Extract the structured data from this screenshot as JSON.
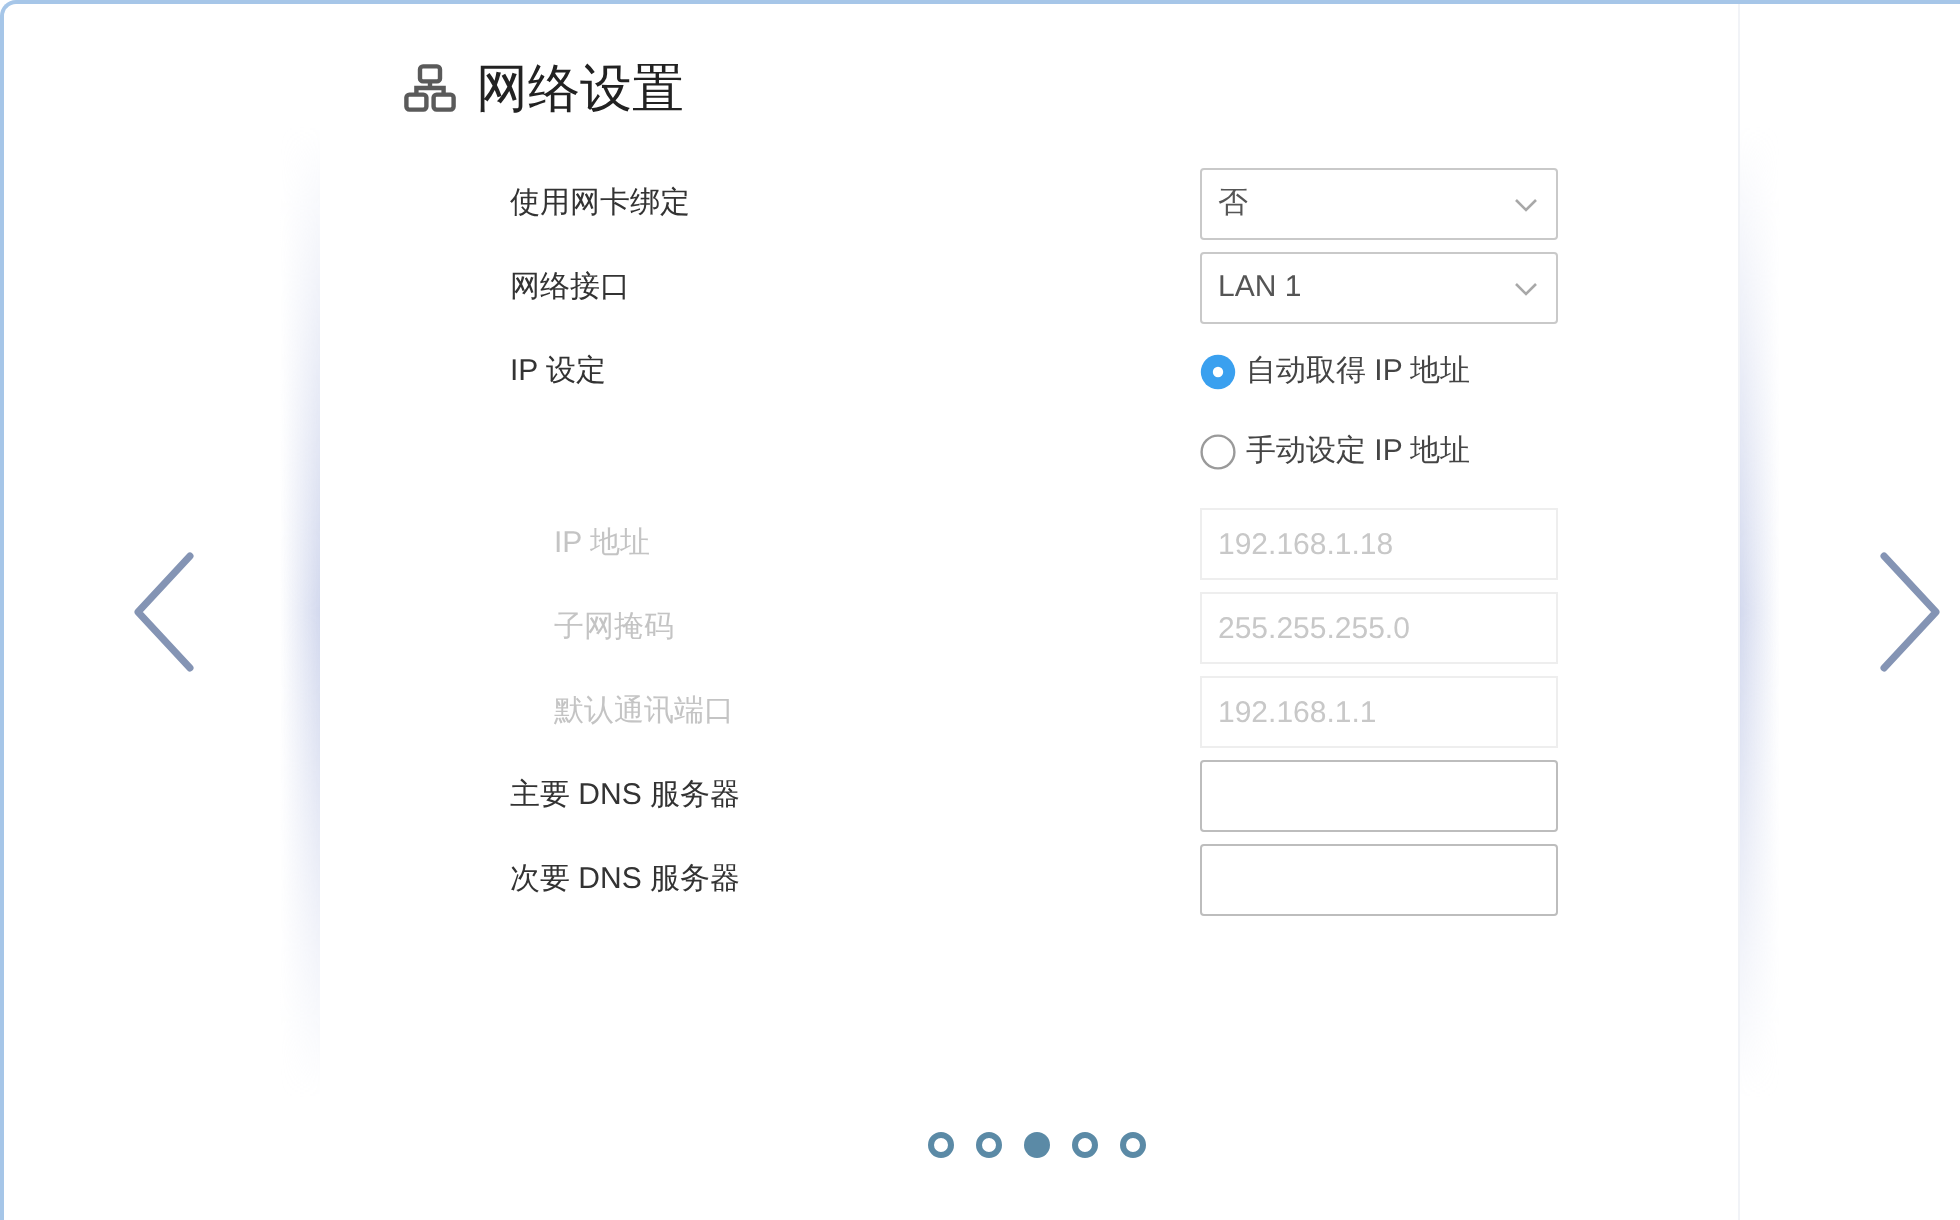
{
  "title": "网络设置",
  "fields": [
    {
      "kind": "select",
      "label": "使用网卡绑定",
      "value": "否",
      "disabled": false
    },
    {
      "kind": "select",
      "label": "网络接口",
      "value": "LAN 1",
      "disabled": false
    },
    {
      "kind": "radio",
      "label": "IP 设定",
      "disabled": false,
      "options": [
        {
          "label": "自动取得 IP 地址",
          "selected": true
        },
        {
          "label": "手动设定 IP 地址",
          "selected": false
        }
      ]
    },
    {
      "kind": "text",
      "label": "IP 地址",
      "value": "192.168.1.18",
      "disabled": true
    },
    {
      "kind": "text",
      "label": "子网掩码",
      "value": "255.255.255.0",
      "disabled": true
    },
    {
      "kind": "text",
      "label": "默认通讯端口",
      "value": "192.168.1.1",
      "disabled": true
    },
    {
      "kind": "text",
      "label": "主要 DNS 服务器",
      "disabled": false
    },
    {
      "kind": "text",
      "label": "次要 DNS 服务器",
      "disabled": false
    }
  ],
  "pager": [
    {
      "selected": false
    },
    {
      "selected": false
    },
    {
      "selected": true
    },
    {
      "selected": false
    },
    {
      "selected": false
    }
  ]
}
